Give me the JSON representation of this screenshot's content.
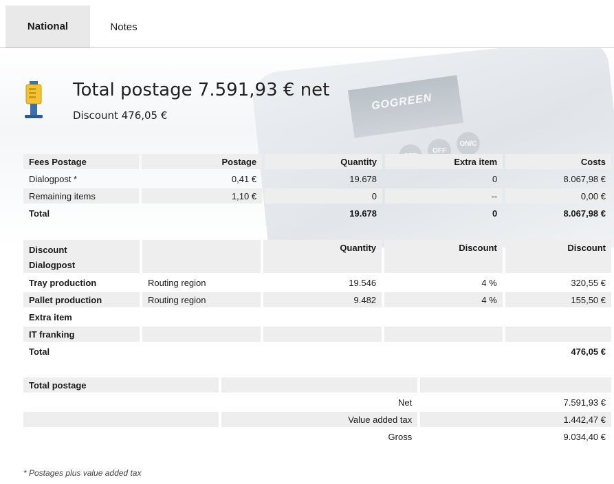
{
  "tabs": [
    {
      "label": "National",
      "active": true
    },
    {
      "label": "Notes",
      "active": false
    }
  ],
  "background": {
    "brand_text": "GOGREEN",
    "keys": [
      "SET",
      "OFF",
      "ON/C"
    ]
  },
  "header": {
    "title": "Total postage 7.591,93 € net",
    "subtitle": "Discount 476,05 €"
  },
  "fees": {
    "headers": [
      "Fees Postage",
      "Postage",
      "Quantity",
      "Extra item",
      "Costs"
    ],
    "rows": [
      [
        "Dialogpost *",
        "0,41 €",
        "19.678",
        "0",
        "8.067,98 €"
      ],
      [
        "Remaining items",
        "1,10 €",
        "0",
        "--",
        "0,00 €"
      ]
    ],
    "total": [
      "Total",
      "",
      "19.678",
      "0",
      "8.067,98 €"
    ]
  },
  "discount": {
    "headers": [
      "Discount\nDialogpost",
      "",
      "Quantity",
      "Discount",
      "Discount"
    ],
    "header_line1": "Discount",
    "header_line2": "Dialogpost",
    "rows": [
      [
        "Tray production",
        "Routing region",
        "19.546",
        "4 %",
        "320,55 €"
      ],
      [
        "Pallet production",
        "Routing region",
        "9.482",
        "4 %",
        "155,50 €"
      ],
      [
        "Extra item",
        "",
        "",
        "",
        ""
      ],
      [
        "IT franking",
        "",
        "",
        "",
        ""
      ]
    ],
    "total": [
      "Total",
      "",
      "",
      "",
      "476,05 €"
    ]
  },
  "total_postage": {
    "header": "Total postage",
    "rows": [
      {
        "label": "Net",
        "value": "7.591,93 €"
      },
      {
        "label": "Value added tax",
        "value": "1.442,47 €"
      },
      {
        "label": "Gross",
        "value": "9.034,40 €"
      }
    ]
  },
  "footnote": "* Postages plus value added tax",
  "colors": {
    "header_bg": "#eeeeee",
    "tab_active_bg": "#e9e9e9",
    "icon_yellow": "#f2c230",
    "icon_blue": "#3a6fb0"
  }
}
